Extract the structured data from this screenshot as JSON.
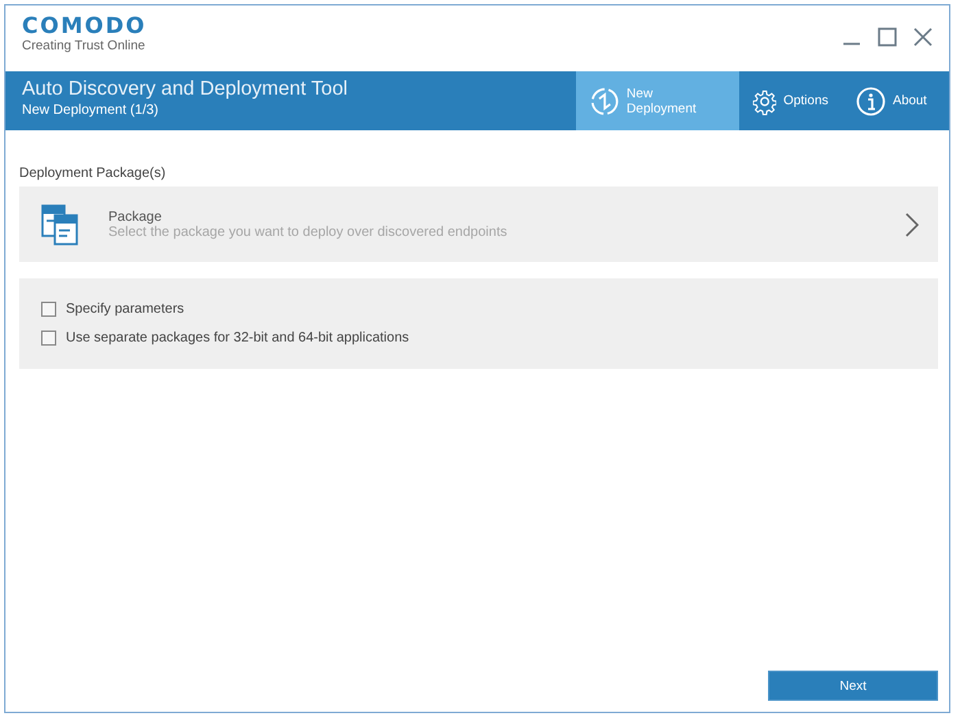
{
  "brand": {
    "name": "COMODO",
    "tagline": "Creating Trust Online"
  },
  "header": {
    "title": "Auto Discovery and Deployment Tool",
    "subtitle": "New Deployment (1/3)"
  },
  "nav": [
    {
      "kind": "deploy",
      "label": "New Deployment",
      "selected": true
    },
    {
      "kind": "options",
      "label": "Options",
      "selected": false
    },
    {
      "kind": "about",
      "label": "About",
      "selected": false
    }
  ],
  "section_label": "Deployment Package(s)",
  "package": {
    "title": "Package",
    "description": "Select the package you want to deploy over discovered endpoints"
  },
  "options": [
    {
      "label": "Specify parameters",
      "checked": false
    },
    {
      "label": "Use separate packages for 32-bit and 64-bit applications",
      "checked": false
    }
  ],
  "buttons": {
    "next": "Next"
  }
}
